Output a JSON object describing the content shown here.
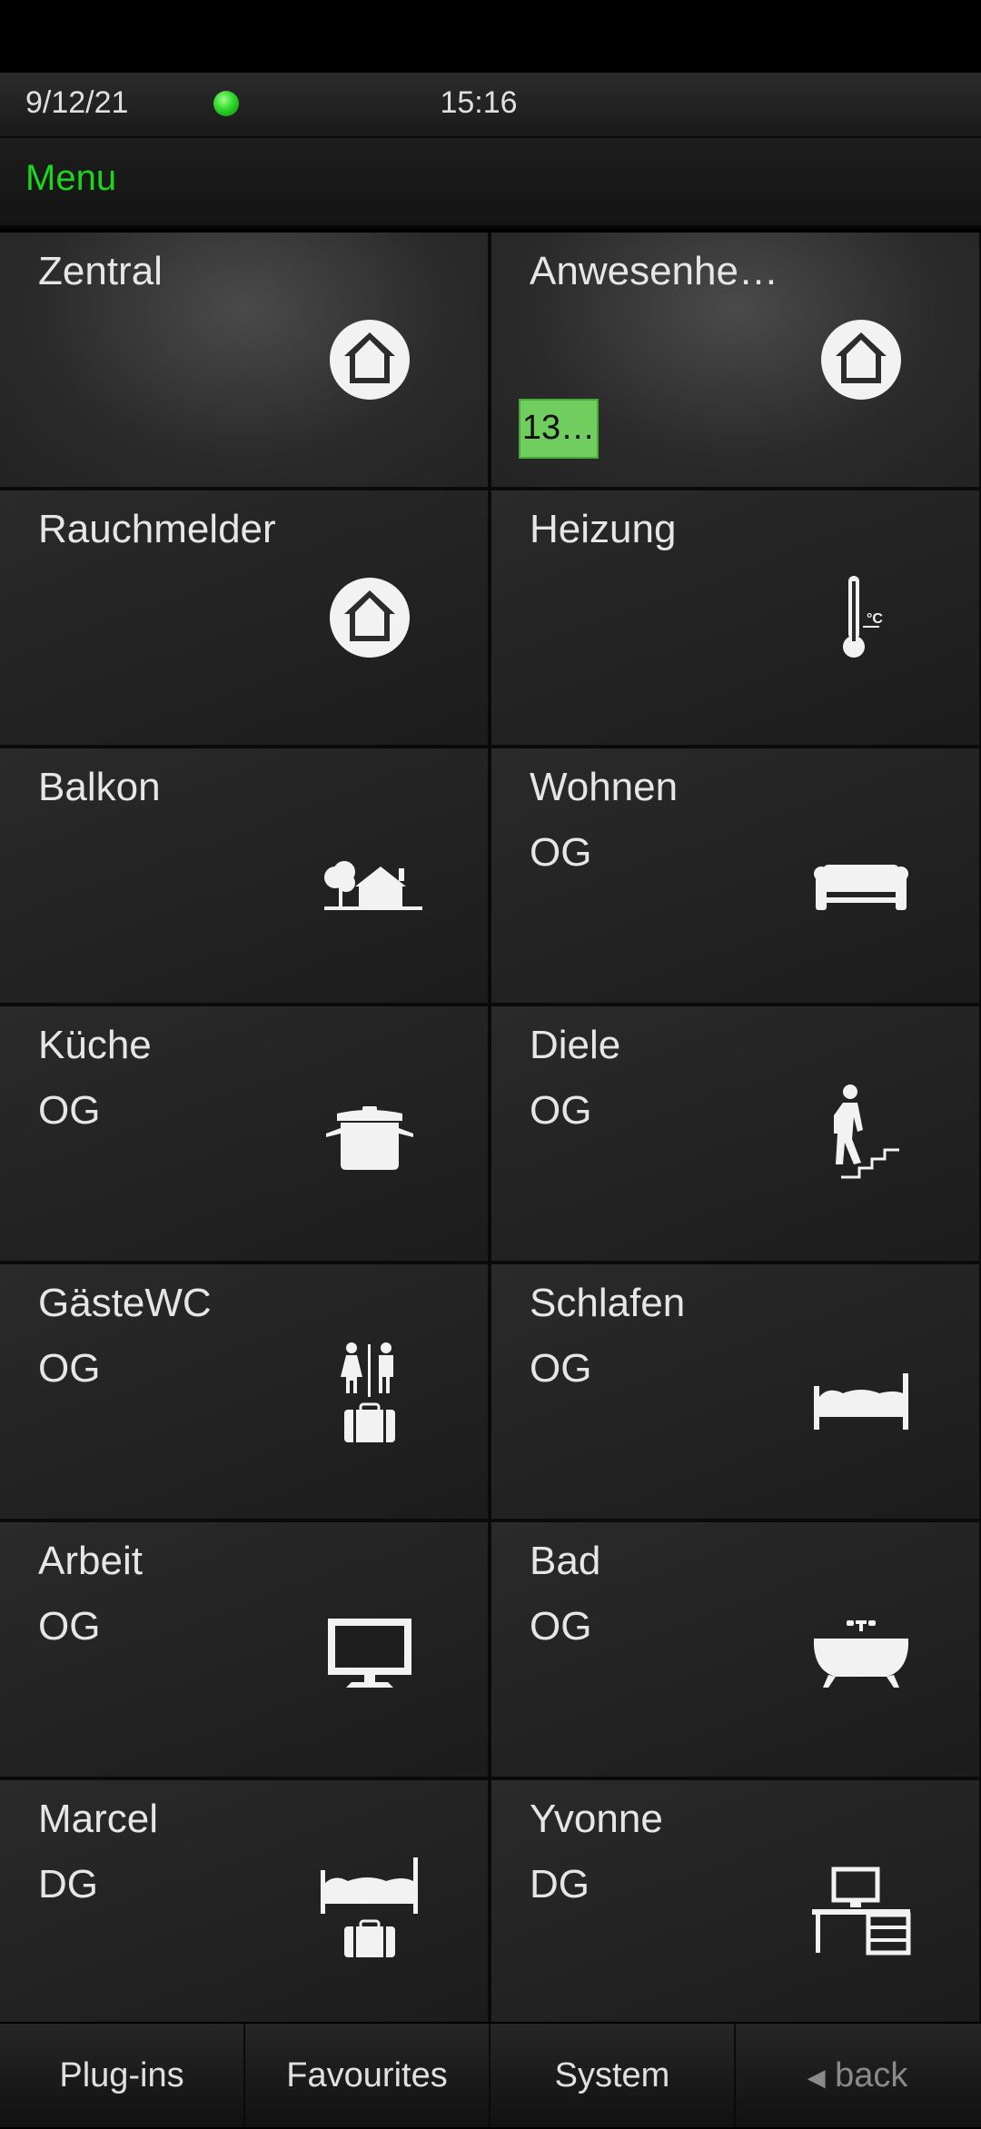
{
  "status": {
    "date": "9/12/21",
    "time": "15:16",
    "led_color": "#2fd62a"
  },
  "header": {
    "menu_label": "Menu"
  },
  "tiles": [
    {
      "title": "Zentral",
      "subtitle": "",
      "icon": "house-circle-icon"
    },
    {
      "title": "Anwesenhe…",
      "subtitle": "",
      "icon": "house-circle-icon",
      "badge": "13…"
    },
    {
      "title": "Rauchmelder",
      "subtitle": "",
      "icon": "house-circle-icon"
    },
    {
      "title": "Heizung",
      "subtitle": "",
      "icon": "thermometer-icon"
    },
    {
      "title": "Balkon",
      "subtitle": "",
      "icon": "tree-house-icon"
    },
    {
      "title": "Wohnen",
      "subtitle": "OG",
      "icon": "sofa-icon"
    },
    {
      "title": "Küche",
      "subtitle": "OG",
      "icon": "cooking-pot-icon"
    },
    {
      "title": "Diele",
      "subtitle": "OG",
      "icon": "stairs-person-icon"
    },
    {
      "title": "GästeWC",
      "subtitle": "OG",
      "icon": "restroom-luggage-icon"
    },
    {
      "title": "Schlafen",
      "subtitle": "OG",
      "icon": "bed-icon"
    },
    {
      "title": "Arbeit",
      "subtitle": "OG",
      "icon": "monitor-icon"
    },
    {
      "title": "Bad",
      "subtitle": "OG",
      "icon": "bathtub-icon"
    },
    {
      "title": "Marcel",
      "subtitle": "DG",
      "icon": "bed-luggage-icon"
    },
    {
      "title": "Yvonne",
      "subtitle": "DG",
      "icon": "desk-icon"
    }
  ],
  "bottom_nav": {
    "plugins": "Plug-ins",
    "favourites": "Favourites",
    "system": "System",
    "back": "back"
  },
  "colors": {
    "accent": "#1fd31f",
    "badge": "#6fce5d",
    "tile_bg": "#1e1e1e",
    "text": "#e6e6e6"
  }
}
